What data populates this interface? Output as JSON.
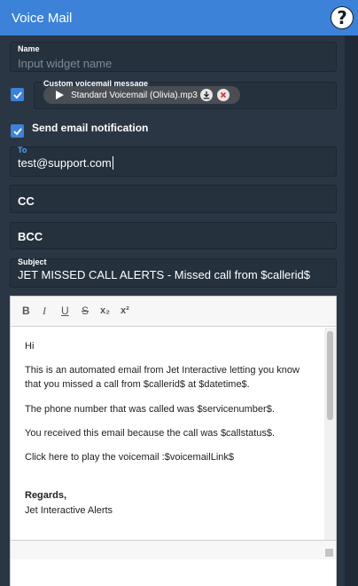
{
  "window": {
    "title": "Voice Mail",
    "help_glyph": "?"
  },
  "name_field": {
    "label": "Name",
    "placeholder": "Input widget name"
  },
  "custom_message": {
    "checked": true,
    "label": "Custom voicemail message",
    "file": "Standard Voicemail (Olivia).mp3"
  },
  "email_notification": {
    "checked": true,
    "label": "Send email notification"
  },
  "to_field": {
    "label": "To",
    "value": "test@support.com"
  },
  "cc_field": {
    "label": "CC"
  },
  "bcc_field": {
    "label": "BCC"
  },
  "subject_field": {
    "label": "Subject",
    "value": "JET MISSED CALL ALERTS - Missed call from $callerid$"
  },
  "editor": {
    "toolbar": {
      "bold": "B",
      "italic": "I",
      "underline": "U",
      "strike": "S",
      "subscript": "x₂",
      "superscript": "x²"
    },
    "lines": [
      "Hi",
      "This is an automated email from Jet Interactive letting you know that you missed a call from $callerid$ at $datetime$.",
      "The phone number that was called was $servicenumber$.",
      "You received this email because the call was $callstatus$.",
      "Click here to play the voicemail :$voicemailLink$",
      "Regards,",
      "Jet Interactive Alerts"
    ]
  },
  "colors": {
    "accent": "#3b82d8",
    "panel": "#2a3644",
    "field": "#26313e"
  }
}
